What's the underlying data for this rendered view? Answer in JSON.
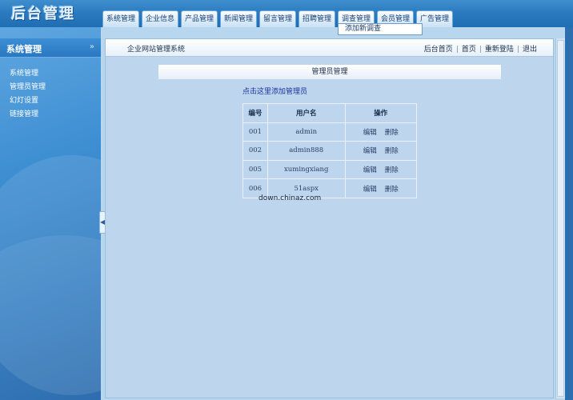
{
  "header": {
    "logo_text": "后台管理",
    "nav": [
      {
        "label": "系统管理"
      },
      {
        "label": "企业信息"
      },
      {
        "label": "产品管理"
      },
      {
        "label": "新闻管理"
      },
      {
        "label": "留言管理"
      },
      {
        "label": "招聘管理"
      },
      {
        "label": "调查管理"
      },
      {
        "label": "会员管理"
      },
      {
        "label": "广告管理"
      }
    ],
    "dropdown_item": "添加新调查"
  },
  "sidebar": {
    "title": "系统管理",
    "chevron": "»",
    "items": [
      {
        "label": "系统管理"
      },
      {
        "label": "管理员管理"
      },
      {
        "label": "幻灯设置"
      },
      {
        "label": "链接管理"
      }
    ]
  },
  "splitter_glyph": "◀",
  "topbar": {
    "site_title": "企业网站管理系统",
    "links": [
      "后台首页",
      "首页",
      "重新登陆",
      "退出"
    ],
    "separator": "|"
  },
  "content": {
    "section_title": "管理员管理",
    "add_link": "点击这里添加管理员",
    "table": {
      "headers": [
        "编号",
        "用户名",
        "操作"
      ],
      "rows": [
        {
          "id": "001",
          "username": "admin",
          "edit": "编辑",
          "delete": "删除"
        },
        {
          "id": "002",
          "username": "admin888",
          "edit": "编辑",
          "delete": "删除"
        },
        {
          "id": "005",
          "username": "xumingxiang",
          "edit": "编辑",
          "delete": "删除"
        },
        {
          "id": "006",
          "username": "51aspx",
          "edit": "编辑",
          "delete": "删除"
        }
      ]
    },
    "watermark": "down.chinaz.com"
  }
}
